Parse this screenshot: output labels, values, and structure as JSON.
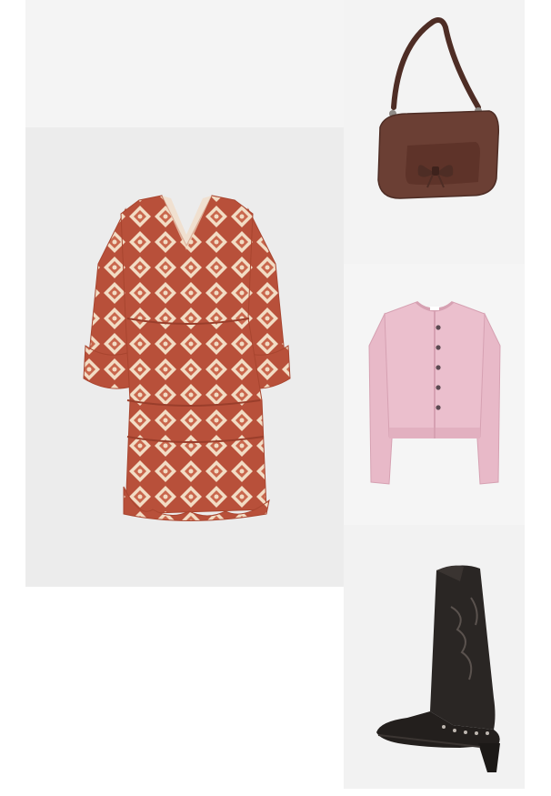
{
  "outfit": {
    "items": [
      {
        "id": "dress",
        "category": "dress",
        "colors": {
          "base": "#b8503a",
          "pattern": "#f2dcc4"
        }
      },
      {
        "id": "bag",
        "category": "shoulder-bag",
        "colors": {
          "base": "#6b3f34"
        }
      },
      {
        "id": "cardigan",
        "category": "cardigan",
        "colors": {
          "base": "#e8b9c8"
        }
      },
      {
        "id": "boot",
        "category": "cowboy-boot",
        "colors": {
          "base": "#2a2624"
        }
      }
    ]
  }
}
